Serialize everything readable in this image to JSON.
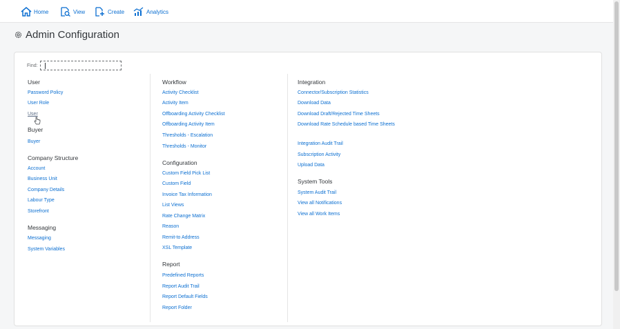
{
  "nav": {
    "home": "Home",
    "view": "View",
    "create": "Create",
    "analytics": "Analytics"
  },
  "page": {
    "title": "Admin Configuration"
  },
  "find": {
    "label": "Find:",
    "value": ""
  },
  "sections": {
    "user": {
      "title": "User",
      "items": [
        "Password Policy",
        "User Role",
        "User"
      ]
    },
    "buyer": {
      "title": "Buyer",
      "items": [
        "Buyer"
      ]
    },
    "company": {
      "title": "Company Structure",
      "items": [
        "Account",
        "Business Unit",
        "Company Details",
        "Labour Type",
        "Storefront"
      ]
    },
    "messaging": {
      "title": "Messaging",
      "items": [
        "Messaging",
        "System Variables"
      ]
    },
    "workflow": {
      "title": "Workflow",
      "items": [
        "Activity Checklist",
        "Activity Item",
        "Offboarding Activity Checklist",
        "Offboarding Activity Item",
        "Thresholds - Escalation",
        "Thresholds - Monitor"
      ]
    },
    "configuration": {
      "title": "Configuration",
      "items": [
        "Custom Field Pick List",
        "Custom Field",
        "Invoice Tax Information",
        "List Views",
        "Rate Change Matrix",
        "Reason",
        "Remit-to Address",
        "XSL Template"
      ]
    },
    "report": {
      "title": "Report",
      "items": [
        "Predefined Reports",
        "Report Audit Trail",
        "Report Default Fields",
        "Report Folder"
      ]
    },
    "integration": {
      "title": "Integration",
      "items": [
        "Connector/Subscription Statistics",
        "Download Data",
        "Download Draft/Rejected Time Sheets",
        "Download Rate Schedule based Time Sheets",
        "Integration Audit Trail",
        "Subscription Activity",
        "Upload Data"
      ]
    },
    "systemtools": {
      "title": "System Tools",
      "items": [
        "System Audit Trail",
        "View all Notifications",
        "View all Work Items"
      ]
    }
  },
  "colors": {
    "link": "#0a6ed1",
    "heading": "#32363a"
  }
}
